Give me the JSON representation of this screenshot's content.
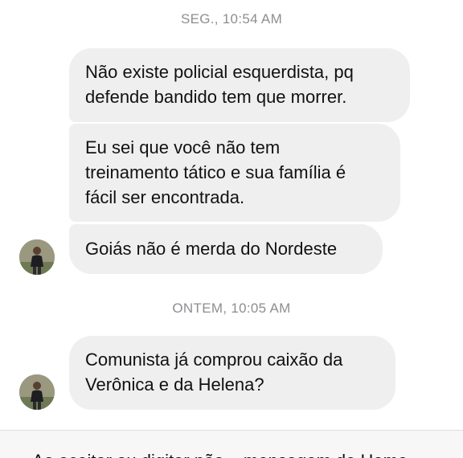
{
  "conversation": {
    "timestamps": [
      "SEG., 10:54 AM",
      "ONTEM, 10:05 AM"
    ],
    "messages": [
      {
        "lines": [
          "Não existe policial esquerdista, pq",
          "defende bandido tem que morrer."
        ]
      },
      {
        "lines": [
          "Eu sei que você não tem",
          "treinamento tático e sua família é",
          "fácil ser encontrada."
        ]
      },
      {
        "lines": [
          "Goiás não é merda do Nordeste"
        ]
      },
      {
        "lines": [
          "Comunista já comprou caixão da",
          "Verônica e da Helena?"
        ]
      }
    ]
  },
  "composer": {
    "partial_text": "Ao aceitar ou digitar não... mensagem de Home"
  },
  "colors": {
    "bubble": "#efefef",
    "timestamp": "#8e8e93",
    "text": "#111111"
  },
  "icons": {
    "avatar": "avatar-photo"
  }
}
